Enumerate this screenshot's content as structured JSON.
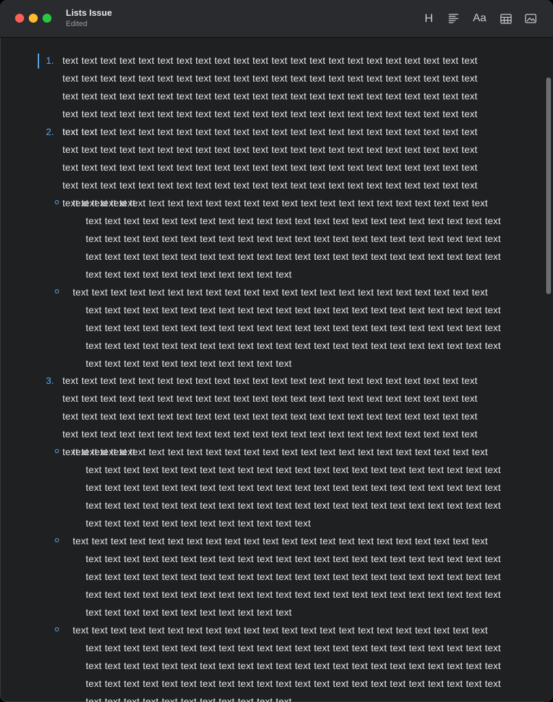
{
  "window": {
    "title": "Lists Issue",
    "subtitle": "Edited"
  },
  "toolbar": {
    "heading_label": "H",
    "font_label": "Aa"
  },
  "list": {
    "items": [
      {
        "marker": "1.",
        "text": "text text text text text text text text text text text text text text text text text text text text text text text text text text text text text text text text text text text text text text text text text text text text text text text text text text text text text text text text text text text text text text text text text text text text text text text text text text text text text text text text text text text text text text text text text text"
      },
      {
        "marker": "2.",
        "text": "text text text text text text text text text text text text text text text text text text text text text text text text text text text text text text text text text text text text text text text text text text text text text text text text text text text text text text text text text text text text text text text text text text text text text text text text text text text text text text text text text text text text text text text text text text text text",
        "children": [
          {
            "text": "text text text text text text text text text text text text text text text text text text text text text text text text text text text text text text text text text text text text text text text text text text text text text text text text text text text text text text text text text text text text text text text text text text text text text text text text text text text text text text text text text text text text text text text text text text text text text text text text text text text"
          },
          {
            "text": "text text text text text text text text text text text text text text text text text text text text text text text text text text text text text text text text text text text text text text text text text text text text text text text text text text text text text text text text text text text text text text text text text text text text text text text text text text text text text text text text text text text text text text text text text text text text text text text text text text text"
          }
        ]
      },
      {
        "marker": "3.",
        "text": "text text text text text text text text text text text text text text text text text text text text text text text text text text text text text text text text text text text text text text text text text text text text text text text text text text text text text text text text text text text text text text text text text text text text text text text text text text text text text text text text text text text text text text text text text text text text",
        "children": [
          {
            "text": "text text text text text text text text text text text text text text text text text text text text text text text text text text text text text text text text text text text text text text text text text text text text text text text text text text text text text text text text text text text text text text text text text text text text text text text text text text text text text text text text text text text text text text text text text text text text text text text text text text text text"
          },
          {
            "text": "text text text text text text text text text text text text text text text text text text text text text text text text text text text text text text text text text text text text text text text text text text text text text text text text text text text text text text text text text text text text text text text text text text text text text text text text text text text text text text text text text text text text text text text text text text text text text text text text text text text"
          },
          {
            "text": "text text text text text text text text text text text text text text text text text text text text text text text text text text text text text text text text text text text text text text text text text text text text text text text text text text text text text text text text text text text text text text text text text text text text text text text text text text text text text text text text text text text text text text text text text text text text text text text text text text text"
          }
        ]
      }
    ]
  },
  "colors": {
    "accent": "#5fa8e8",
    "background": "#1f2022",
    "titlebar": "#2a2b2e",
    "text": "#e8e8ea"
  }
}
